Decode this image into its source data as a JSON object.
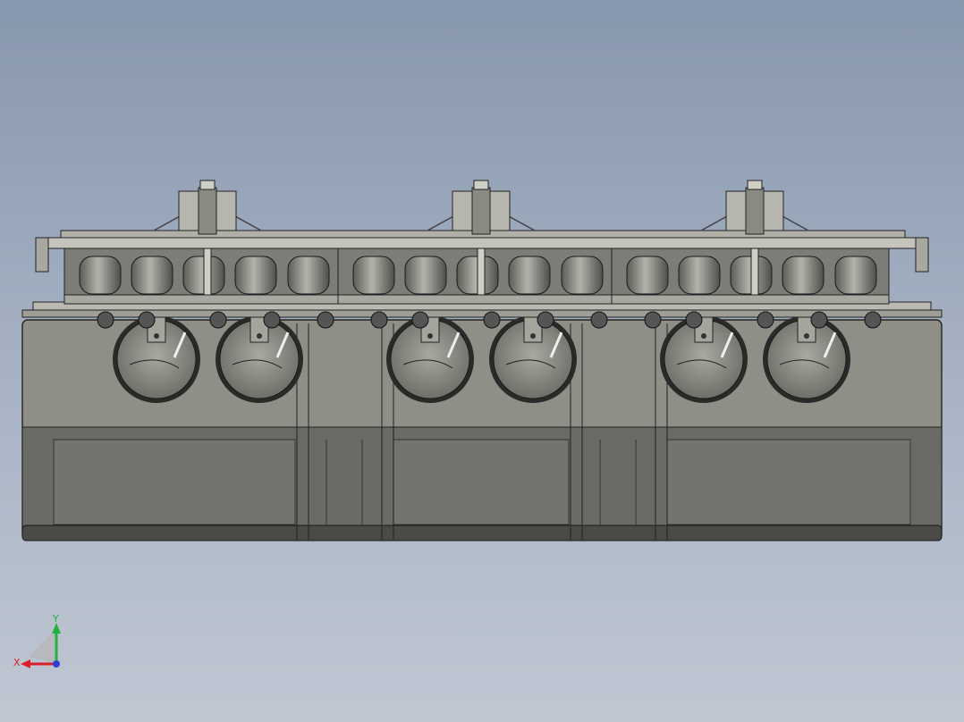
{
  "viewport": {
    "background_top": "#8797ad",
    "background_bottom": "#c0c7d3",
    "model_fill": "#8e8e86",
    "model_dark": "#5d5d57",
    "model_line": "#1e1e1c"
  },
  "model": {
    "modules": 3,
    "rollers_per_module": 2,
    "icon": "cad-assembly-icon"
  },
  "triad": {
    "x_label": "X",
    "y_label": "Y",
    "x_color": "#d9202a",
    "y_color": "#23b043",
    "z_color": "#2a3fd6"
  }
}
